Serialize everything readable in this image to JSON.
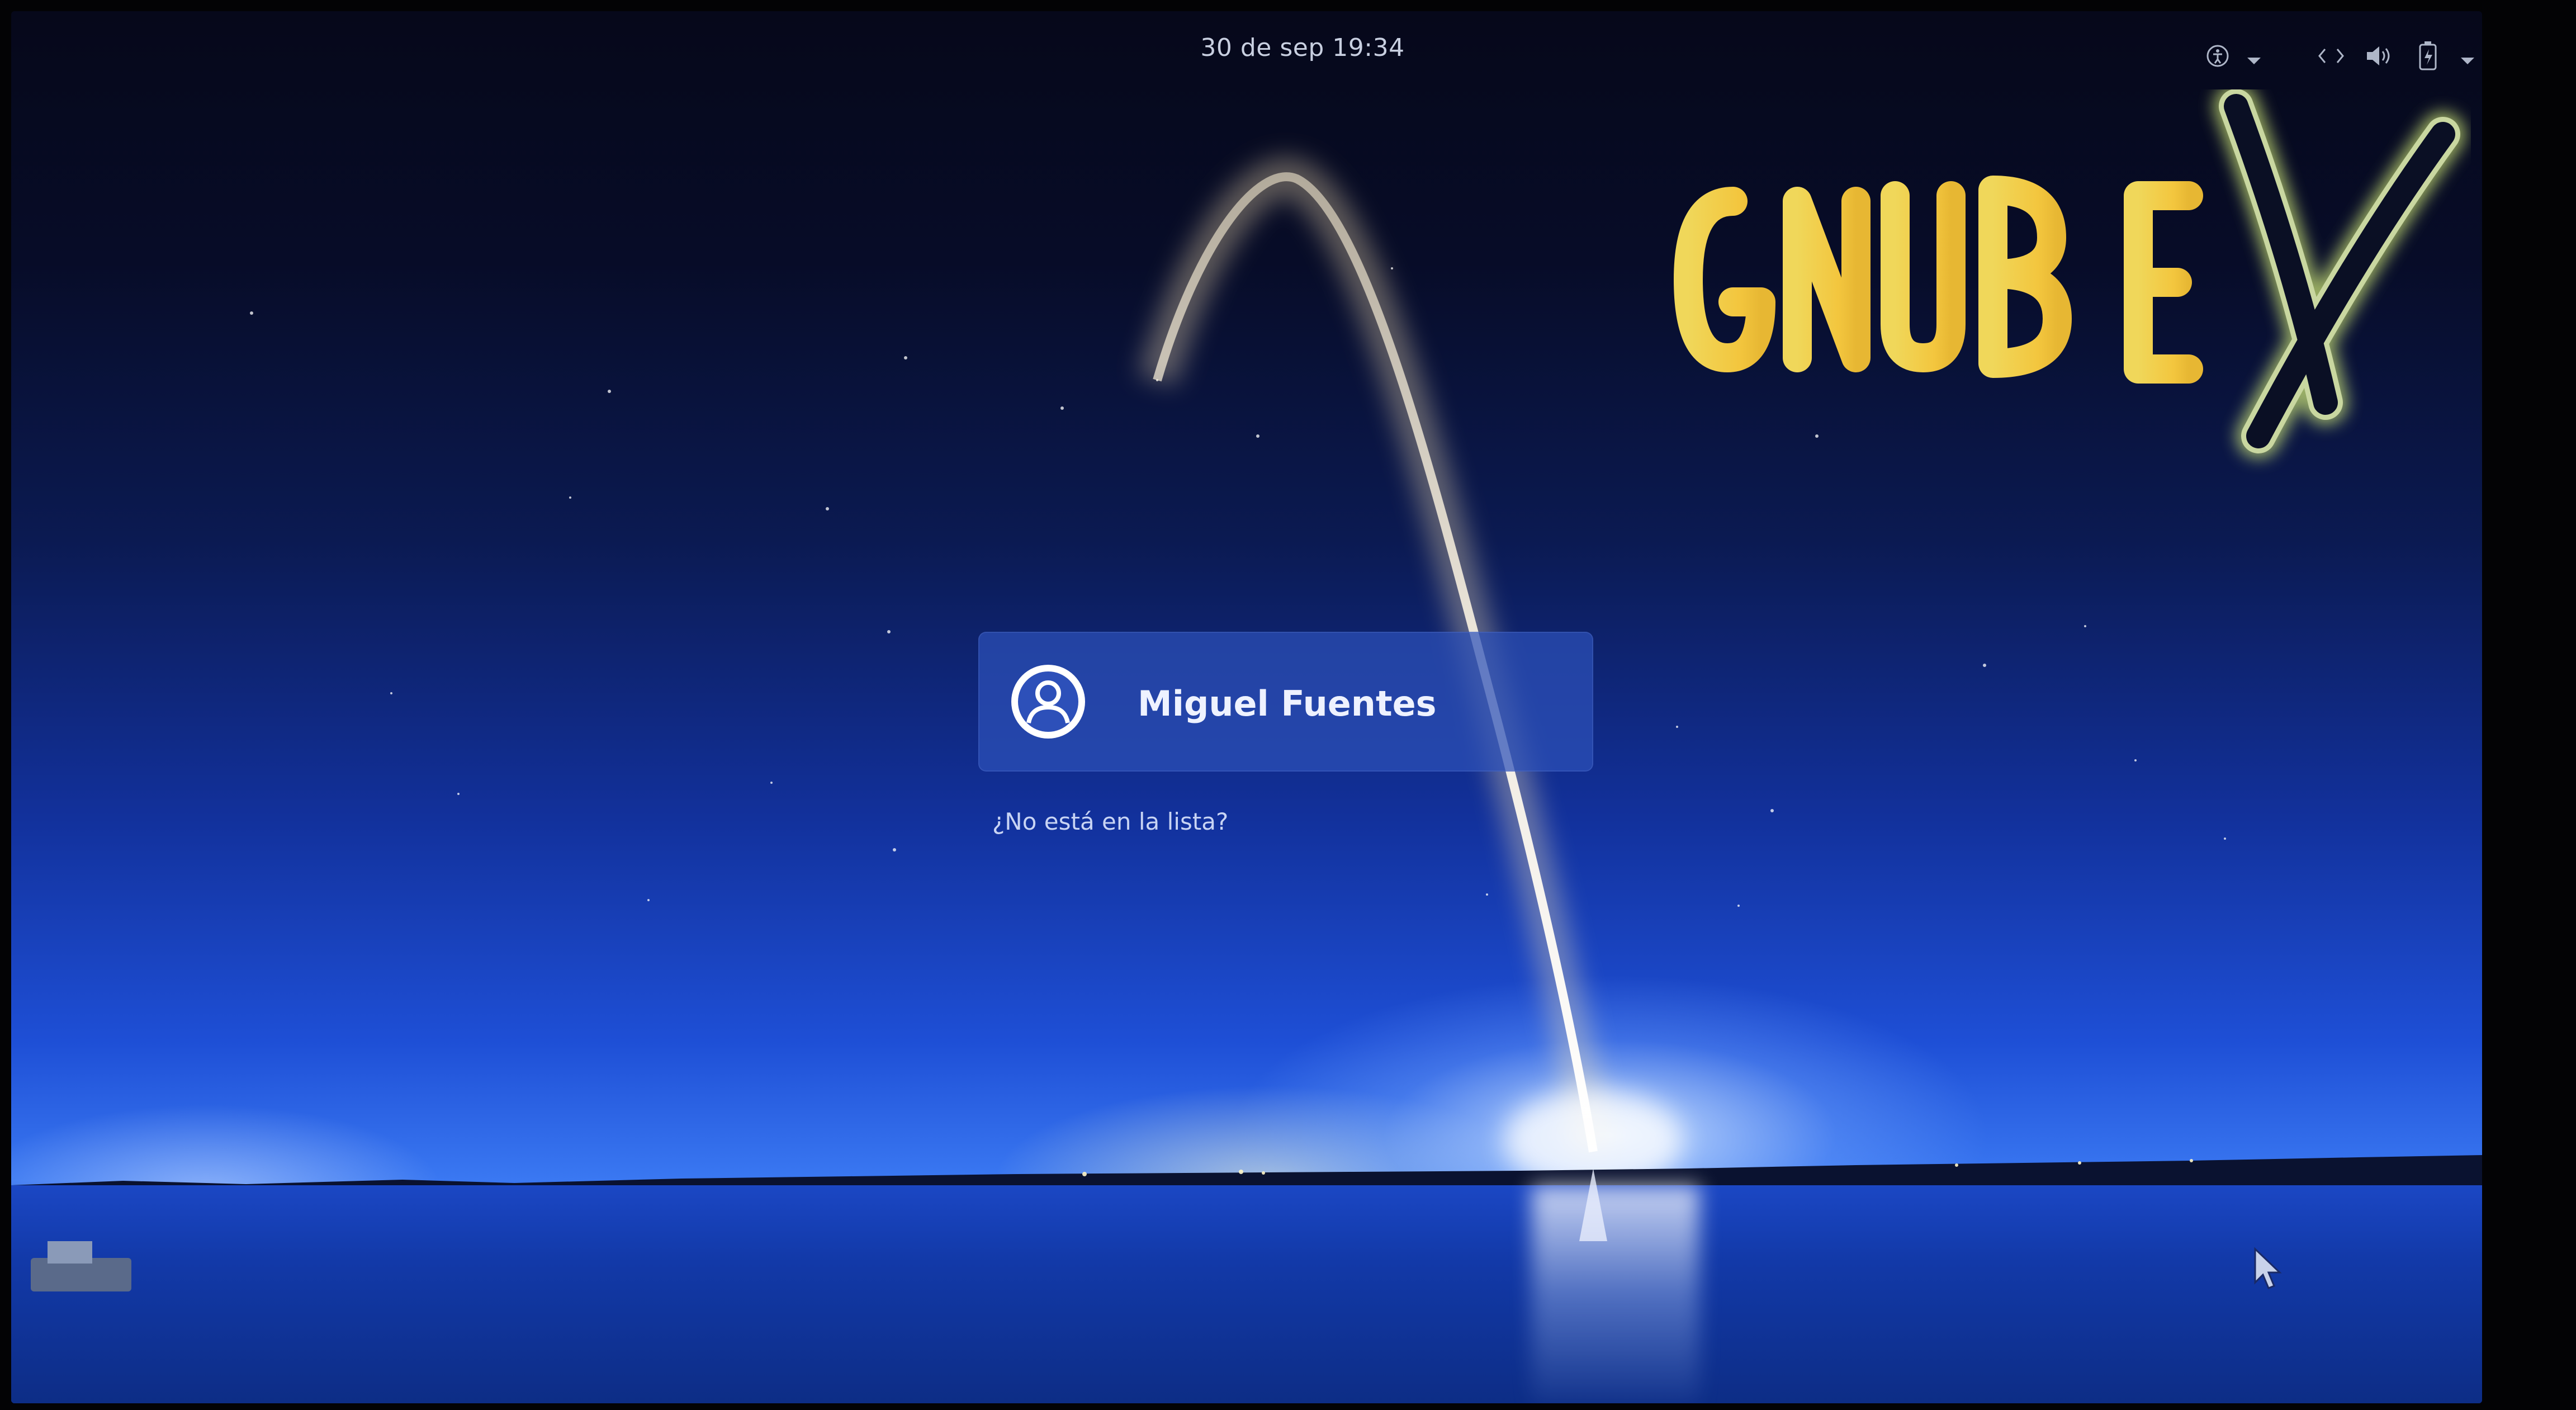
{
  "top_bar": {
    "clock": "30 de sep  19:34",
    "tray_icons": [
      "accessibility-icon",
      "dropdown-arrow-icon",
      "network-icon",
      "volume-icon",
      "battery-icon",
      "power-menu-arrow-icon"
    ]
  },
  "logo": {
    "text": "GNUBIEX"
  },
  "login": {
    "user_name": "Miguel Fuentes",
    "not_listed": "¿No está en la lista?"
  },
  "colors": {
    "sky_top": "#06081a",
    "sky_horizon": "#3a78f2",
    "card": "#2d50b9",
    "logo_yellow": "#f2cf4a",
    "logo_x_outline": "#0a0f24"
  }
}
